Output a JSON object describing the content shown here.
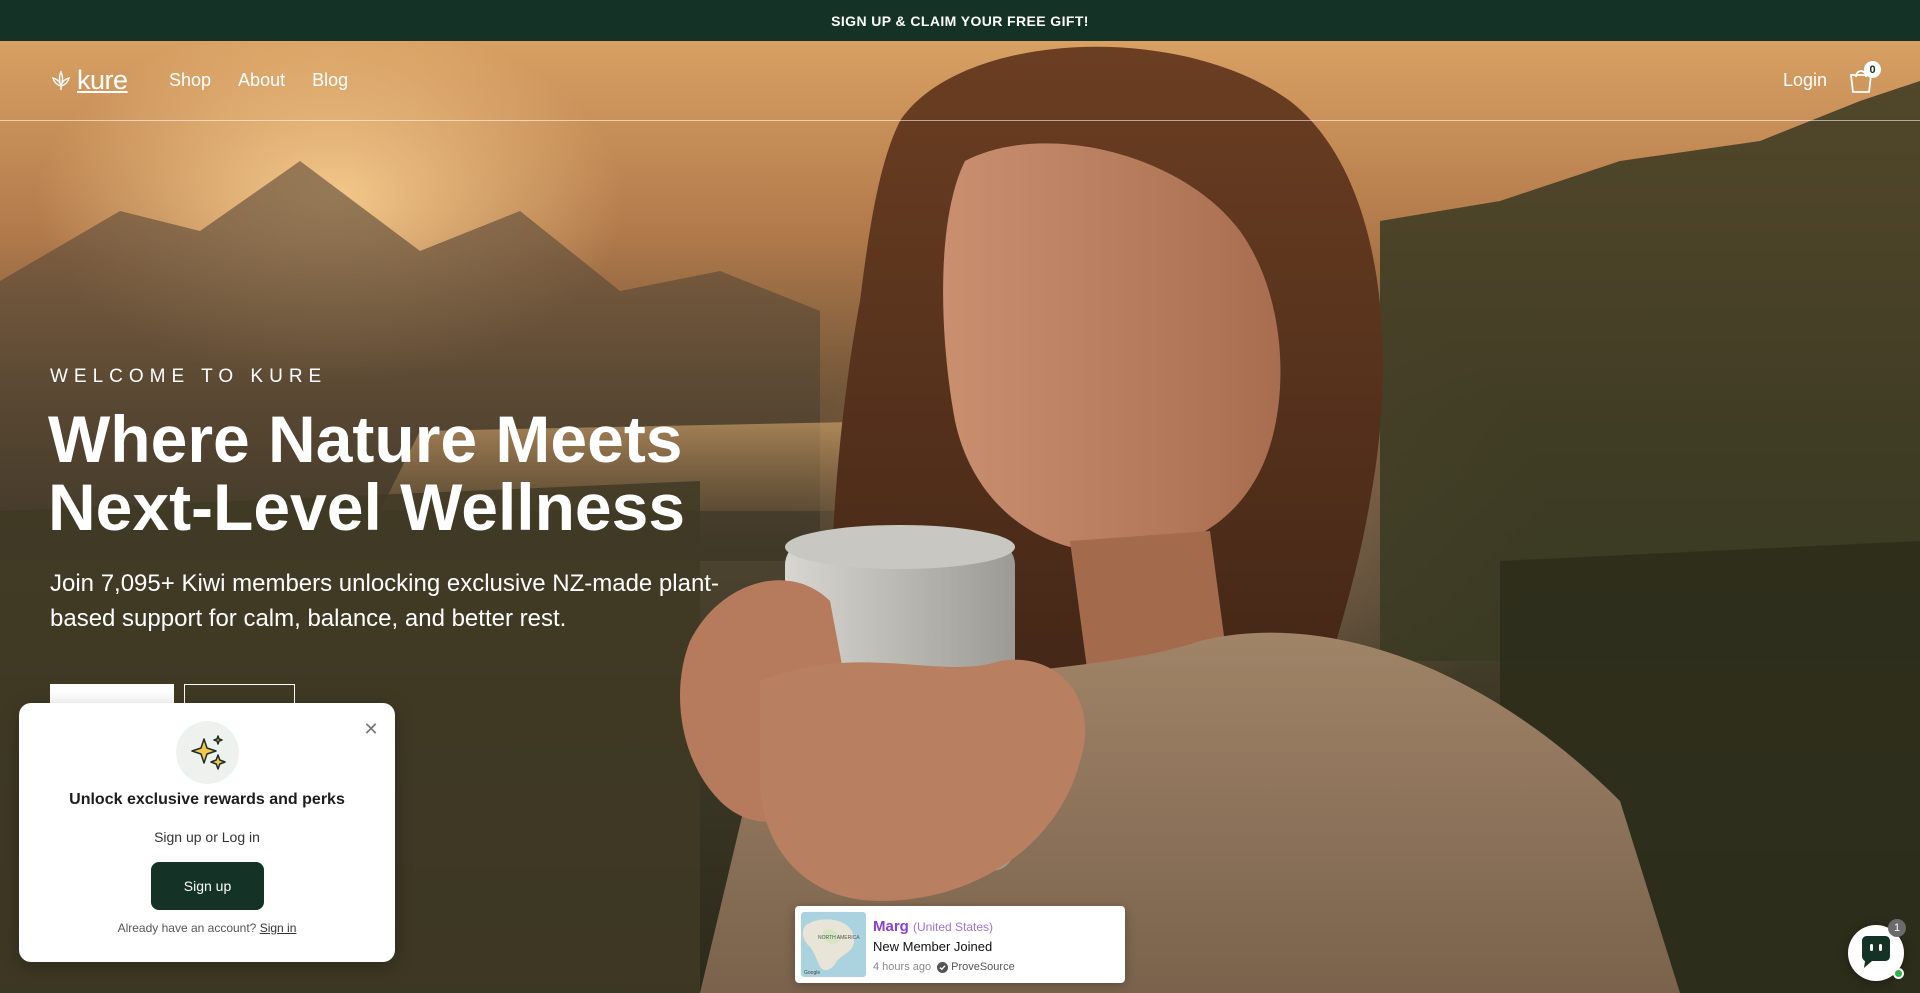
{
  "announcement": {
    "text": "SIGN UP & CLAIM YOUR FREE GIFT!"
  },
  "header": {
    "logo_text": "kure",
    "nav": [
      {
        "label": "Shop"
      },
      {
        "label": "About"
      },
      {
        "label": "Blog"
      }
    ],
    "login_label": "Login",
    "cart_count": "0"
  },
  "hero": {
    "eyebrow": "WELCOME TO KURE",
    "headline_line1": "Where Nature Meets",
    "headline_line2": "Next-Level Wellness",
    "subcopy": "Join 7,095+ Kiwi members unlocking exclusive NZ-made plant-based support for calm, balance, and better rest."
  },
  "rewards_popup": {
    "title": "Unlock exclusive rewards and perks",
    "subtitle": "Sign up or Log in",
    "signup_label": "Sign up",
    "already_text": "Already have an account?",
    "signin_link": "Sign in"
  },
  "social_proof": {
    "name": "Marg",
    "location": "(United States)",
    "event": "New Member Joined",
    "time": "4 hours ago",
    "source": "ProveSource",
    "map_label": "NORTH AMERICA",
    "map_credit": "Google"
  },
  "chat": {
    "badge": "1"
  },
  "colors": {
    "brand_dark_green": "#143226",
    "proof_name_purple": "#8a3fd1",
    "online_green": "#2fb34a"
  }
}
